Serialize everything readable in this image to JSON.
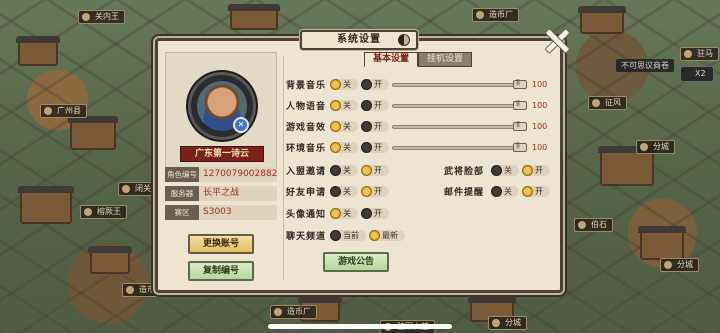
{
  "dialog": {
    "title": "系统设置"
  },
  "tabs": [
    {
      "label": "基本设置",
      "active": true
    },
    {
      "label": "挂机设置",
      "active": false
    }
  ],
  "profile": {
    "name": "广东第一诗云",
    "badge": "✕",
    "info": [
      {
        "label": "角色编号",
        "value": "1270079002882"
      },
      {
        "label": "服务器",
        "value": "长平之战"
      },
      {
        "label": "赛区",
        "value": "S3003"
      }
    ],
    "change_account": "更换账号",
    "copy_id": "复制编号"
  },
  "sound": [
    {
      "label": "背景音乐",
      "off": "关",
      "on": "开",
      "selected": "off",
      "volume": 100
    },
    {
      "label": "人物语音",
      "off": "关",
      "on": "开",
      "selected": "off",
      "volume": 100
    },
    {
      "label": "游戏音效",
      "off": "关",
      "on": "开",
      "selected": "off",
      "volume": 100
    },
    {
      "label": "环境音乐",
      "off": "关",
      "on": "开",
      "selected": "off",
      "volume": 100
    }
  ],
  "toggles": {
    "alliance_invite": {
      "label": "入盟邀请",
      "off": "关",
      "on": "开",
      "selected": "on"
    },
    "friend_request": {
      "label": "好友申请",
      "off": "关",
      "on": "开",
      "selected": "on"
    },
    "avatar_notice": {
      "label": "头像通知",
      "off": "关",
      "on": "开",
      "selected": "off"
    },
    "general_face": {
      "label": "武将脸部",
      "off": "关",
      "on": "开",
      "selected": "on"
    },
    "mail_remind": {
      "label": "邮件提醒",
      "off": "关",
      "on": "开",
      "selected": "on"
    }
  },
  "chat_channel": {
    "label": "聊天频道",
    "current": "当前",
    "latest": "最新",
    "selected": "latest"
  },
  "announcement_button": "游戏公告",
  "map_labels": {
    "top_left": "关内王",
    "top_right": "造币厂",
    "left_mid": "广州县",
    "left_low1": "闭关",
    "left_low2": "榕厥王",
    "right_top": "驻马",
    "right_sub": "不可思议商卷",
    "right_x": "X2",
    "right_mid1": "征风",
    "right_mid2": "分城",
    "right_low1": "伯石",
    "right_low2": "分城",
    "bottom_left": "造币",
    "bottom_mid": "驻军大营",
    "bottom_mid2": "造币厂",
    "bottom_right": "分城"
  }
}
